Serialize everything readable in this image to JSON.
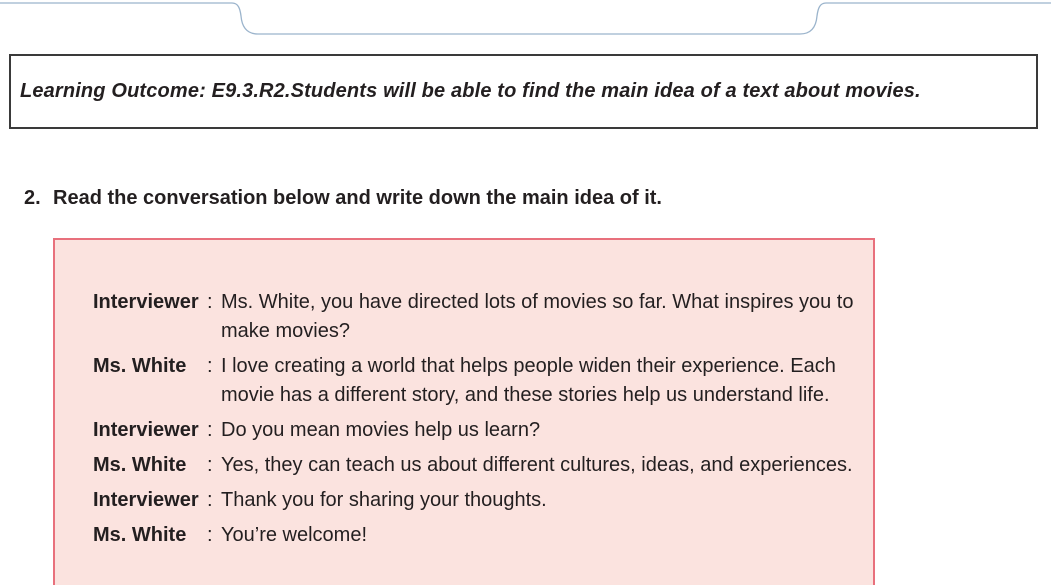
{
  "learning_outcome": "Learning Outcome: E9.3.R2.Students will be able to find the main idea of a text about movies.",
  "task": {
    "number": "2.",
    "instruction": "Read the conversation below and write down the main idea of it."
  },
  "dialog": [
    {
      "speaker": "Interviewer",
      "text": "Ms. White, you have directed lots of movies so far. What inspires you to make movies?"
    },
    {
      "speaker": "Ms. White",
      "text": "I love creating a world that helps people widen their experience. Each movie has a different story, and these stories help us understand life."
    },
    {
      "speaker": "Interviewer",
      "text": "Do you mean movies help us learn?"
    },
    {
      "speaker": "Ms. White",
      "text": "Yes, they can teach us about different cultures, ideas, and experiences."
    },
    {
      "speaker": "Interviewer",
      "text": "Thank you for sharing your thoughts."
    },
    {
      "speaker": "Ms. White",
      "text": "You’re welcome!"
    }
  ],
  "colors": {
    "panel_background": "#fbe3df",
    "panel_border": "#e8707c",
    "header_line": "#9bb4cc"
  }
}
